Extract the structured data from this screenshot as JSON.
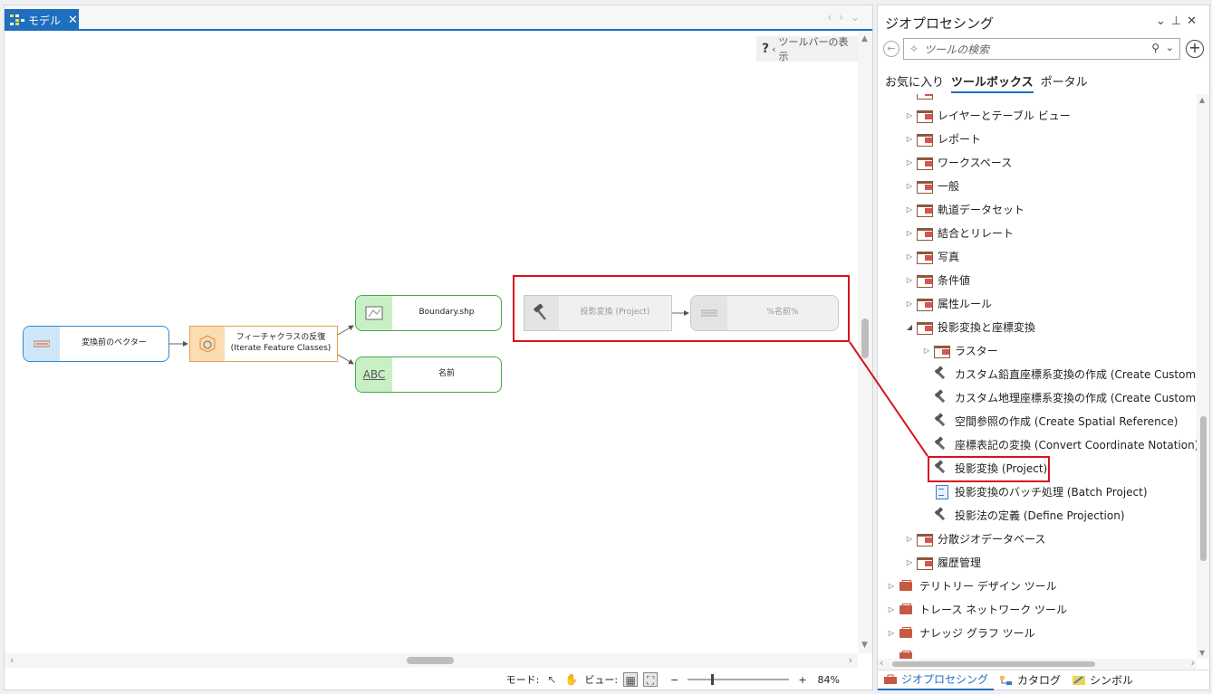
{
  "model_tab": {
    "label": "モデル"
  },
  "canvas": {
    "toolbar_toggle_label": "ツールバーの表示"
  },
  "nodes": {
    "input_variable": "変換前のベクター",
    "iterator": "フィーチャクラスの反復 (Iterate Feature Classes)",
    "boundary_output": "Boundary.shp",
    "name_output": "名前",
    "name_icon_text": "ABC",
    "project_tool": "投影変換 (Project)",
    "project_output": "%名前%"
  },
  "statusbar": {
    "mode_label": "モード:",
    "view_label": "ビュー:",
    "zoom_minus": "−",
    "zoom_plus": "+",
    "zoom_value": "84%"
  },
  "gp": {
    "title": "ジオプロセシング",
    "search_placeholder": "ツールの検索",
    "tabs": [
      "お気に入り",
      "ツールボックス",
      "ポータル"
    ],
    "tree": [
      {
        "label": "レイヤーとテーブル ビュー"
      },
      {
        "label": "レポート"
      },
      {
        "label": "ワークスペース"
      },
      {
        "label": "一般"
      },
      {
        "label": "軌道データセット"
      },
      {
        "label": "結合とリレート"
      },
      {
        "label": "写真"
      },
      {
        "label": "条件値"
      },
      {
        "label": "属性ルール"
      },
      {
        "label": "投影変換と座標変換"
      },
      {
        "label": "ラスター"
      },
      {
        "label": "カスタム鉛直座標系変換の作成 (Create Custom Vert"
      },
      {
        "label": "カスタム地理座標系変換の作成 (Create Custom Geo"
      },
      {
        "label": "空間参照の作成 (Create Spatial Reference)"
      },
      {
        "label": "座標表記の変換 (Convert Coordinate Notation)"
      },
      {
        "label": "投影変換 (Project)"
      },
      {
        "label": "投影変換のバッチ処理 (Batch Project)"
      },
      {
        "label": "投影法の定義 (Define Projection)"
      },
      {
        "label": "分散ジオデータベース"
      },
      {
        "label": "履歴管理"
      },
      {
        "label": "テリトリー デザイン ツール"
      },
      {
        "label": "トレース ネットワーク ツール"
      },
      {
        "label": "ナレッジ グラフ ツール"
      }
    ],
    "bottom_tabs": [
      "ジオプロセシング",
      "カタログ",
      "シンボル"
    ]
  },
  "colors": {
    "accent": "#1e6fbf",
    "annotation_red": "#d8121d",
    "toolbox_red": "#c55a43"
  }
}
